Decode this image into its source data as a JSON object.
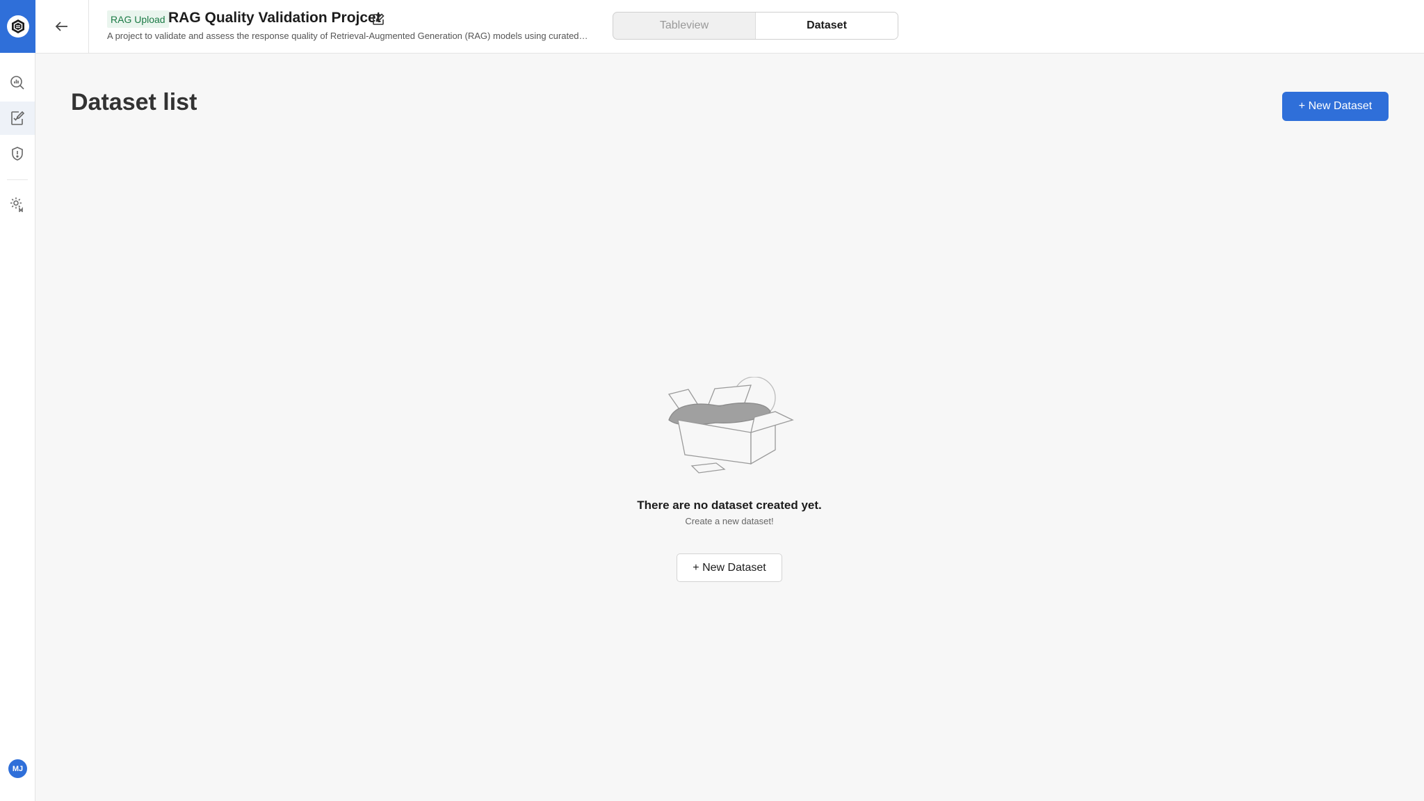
{
  "header": {
    "badge": "RAG Upload",
    "title": "RAG Quality Validation Projcet",
    "description": "A project to validate and assess the response quality of Retrieval-Augmented Generation (RAG) models using curated…",
    "tabs": [
      {
        "label": "Tableview",
        "active": false
      },
      {
        "label": "Dataset",
        "active": true
      }
    ]
  },
  "sidebar": {
    "items": [
      {
        "icon": "analytics-search-icon",
        "active": false
      },
      {
        "icon": "edit-checklist-icon",
        "active": true
      },
      {
        "icon": "shield-alert-icon",
        "active": false
      },
      {
        "icon": "settings-user-icon",
        "active": false
      }
    ],
    "avatar": "MJ"
  },
  "main": {
    "title": "Dataset list",
    "new_button": "+ New Dataset",
    "empty": {
      "title": "There are no dataset created yet.",
      "subtitle": "Create a new dataset!",
      "button": "+ New Dataset"
    }
  },
  "colors": {
    "accent": "#2f6fd9",
    "badge_bg": "#eaf5ee",
    "badge_text": "#1b7a45",
    "background": "#f7f7f7"
  }
}
